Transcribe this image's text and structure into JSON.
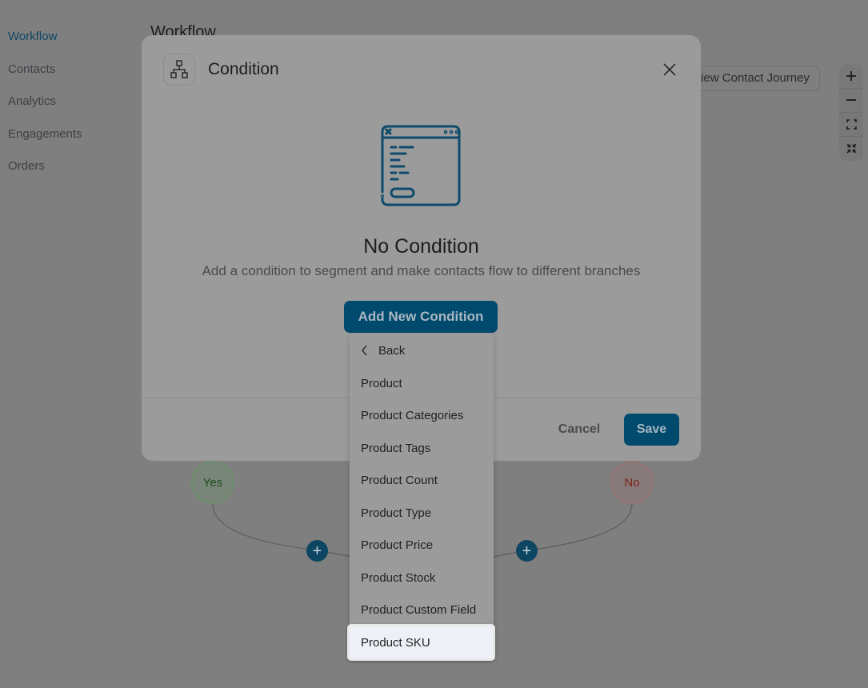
{
  "sidebar": {
    "items": [
      {
        "label": "Workflow",
        "active": true
      },
      {
        "label": "Contacts",
        "active": false
      },
      {
        "label": "Analytics",
        "active": false
      },
      {
        "label": "Engagements",
        "active": false
      },
      {
        "label": "Orders",
        "active": false
      }
    ]
  },
  "page": {
    "title": "Workflow",
    "view_journey_label": "View Contact Journey",
    "zoom_controls": [
      "zoom-in-icon",
      "zoom-out-icon",
      "fit-view-icon",
      "collapse-icon"
    ]
  },
  "canvas": {
    "yes_label": "Yes",
    "no_label": "No",
    "add_step_symbol": "+"
  },
  "modal": {
    "title": "Condition",
    "icon": "sitemap-icon",
    "close_symbol": "close-icon",
    "empty_title": "No Condition",
    "empty_subtitle": "Add a condition to segment and make contacts flow to different branches",
    "add_button_label": "Add New Condition",
    "cancel_label": "Cancel",
    "save_label": "Save"
  },
  "dropdown": {
    "back_label": "Back",
    "items": [
      "Product",
      "Product Categories",
      "Product Tags",
      "Product Count",
      "Product Type",
      "Product Price",
      "Product Stock",
      "Product Custom Field",
      "Product SKU"
    ],
    "highlighted": "Product SKU"
  },
  "colors": {
    "brand": "#004a6e",
    "overlay_bg": "#7f7f7f",
    "modal_bg": "#9b9b9b",
    "highlight_bg": "#eef0f8"
  }
}
